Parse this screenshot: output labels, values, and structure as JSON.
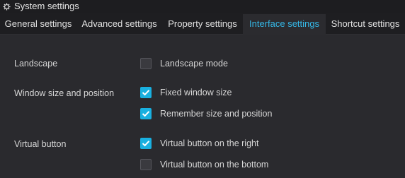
{
  "window": {
    "title": "System settings",
    "title_icon": "gear-icon"
  },
  "tabs": [
    {
      "label": "General settings",
      "active": false
    },
    {
      "label": "Advanced settings",
      "active": false
    },
    {
      "label": "Property settings",
      "active": false
    },
    {
      "label": "Interface settings",
      "active": true
    },
    {
      "label": "Shortcut settings",
      "active": false
    }
  ],
  "sections": {
    "landscape": {
      "label": "Landscape",
      "options": [
        {
          "label": "Landscape mode",
          "checked": false
        }
      ]
    },
    "window_size": {
      "label": "Window size and position",
      "options": [
        {
          "label": "Fixed window size",
          "checked": true
        },
        {
          "label": "Remember size and position",
          "checked": true
        }
      ]
    },
    "virtual_button": {
      "label": "Virtual button",
      "options": [
        {
          "label": "Virtual button on the right",
          "checked": true
        },
        {
          "label": "Virtual button on the bottom",
          "checked": false
        }
      ]
    }
  },
  "colors": {
    "accent": "#19b0e0",
    "active_tab_text": "#35b7e6",
    "background": "#2a2a2e",
    "titlebar": "#1d1d20"
  }
}
